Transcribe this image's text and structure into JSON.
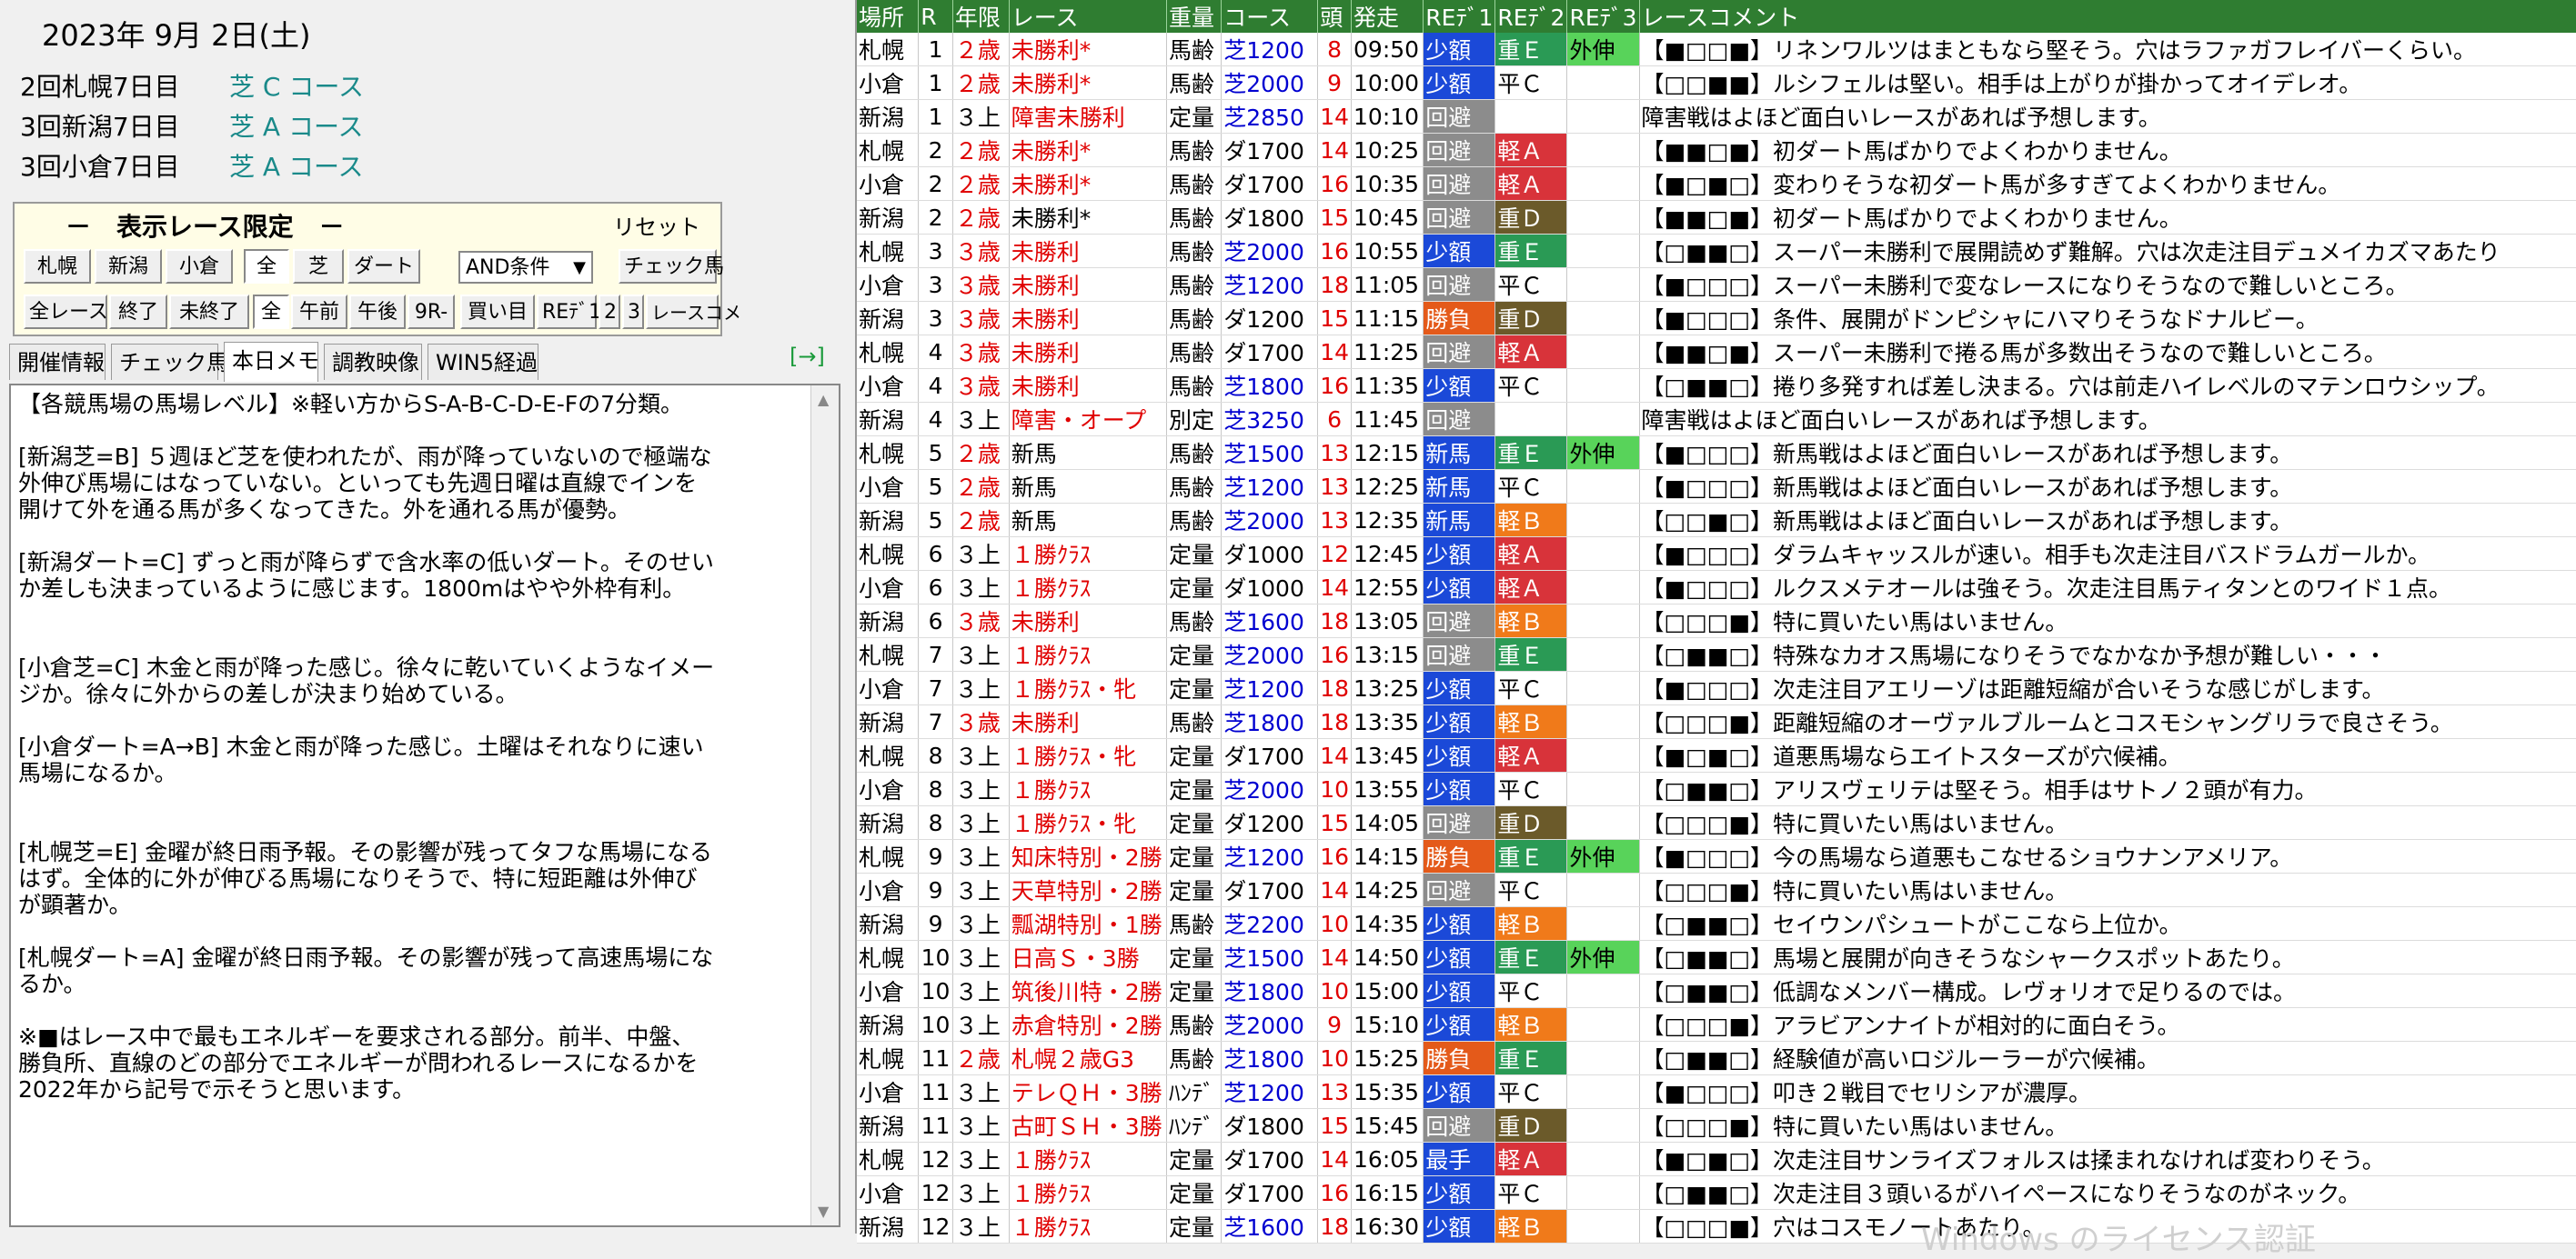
{
  "date": "2023年  9月  2日(土)",
  "meetings": [
    {
      "name": "2回札幌7日目",
      "course": "芝 C コース"
    },
    {
      "name": "3回新潟7日目",
      "course": "芝 A コース"
    },
    {
      "name": "3回小倉7日目",
      "course": "芝 A コース"
    }
  ],
  "filter": {
    "title": "－　表示レース限定　－",
    "reset": "リセット",
    "row1": [
      "札幌",
      "新潟",
      "小倉"
    ],
    "row1b": [
      "全",
      "芝",
      "ダート"
    ],
    "condition": "AND条件",
    "check_btn": "チェック馬",
    "row2a": [
      "全レース",
      "終了",
      "未終了"
    ],
    "row2b": [
      "全",
      "午前",
      "午後",
      "9R-"
    ],
    "row2c": [
      "買い目",
      "REﾃﾞ1",
      "2",
      "3",
      "レースコメ"
    ]
  },
  "tabs": [
    "開催情報",
    "チェック馬",
    "本日メモ",
    "調教映像",
    "WIN5経過"
  ],
  "expand": "[→]",
  "memo": "【各競馬場の馬場レベル】※軽い方からS-A-B-C-D-E-Fの7分類。\n\n[新潟芝=B] ５週ほど芝を使われたが、雨が降っていないので極端な\n外伸び馬場にはなっていない。といっても先週日曜は直線でインを\n開けて外を通る馬が多くなってきた。外を通れる馬が優勢。\n\n[新潟ダート=C] ずっと雨が降らずで含水率の低いダート。そのせい\nか差しも決まっているように感じます。1800mはやや外枠有利。\n\n\n[小倉芝=C] 木金と雨が降った感じ。徐々に乾いていくようなイメー\nジか。徐々に外からの差しが決まり始めている。\n\n[小倉ダート=A→B] 木金と雨が降った感じ。土曜はそれなりに速い\n馬場になるか。\n\n\n[札幌芝=E] 金曜が終日雨予報。その影響が残ってタフな馬場になる\nはず。全体的に外が伸びる馬場になりそうで、特に短距離は外伸び\nが顕著か。\n\n[札幌ダート=A] 金曜が終日雨予報。その影響が残って高速馬場にな\nるか。\n\n※■はレース中で最もエネルギーを要求される部分。前半、中盤、\n勝負所、直線のどの部分でエネルギーが問われるレースになるかを\n2022年から記号で示そうと思います。",
  "columns": [
    "場所",
    "R",
    "年限",
    "レース",
    "重量",
    "コース",
    "頭",
    "発走",
    "REﾃﾞ1",
    "REﾃﾞ2",
    "REﾃﾞ3",
    "レースコメント"
  ],
  "rows": [
    [
      "札幌",
      "1",
      "２歳",
      "未勝利*",
      "馬齢",
      "芝1200",
      "8",
      "09:50",
      "少額",
      "重Ｅ",
      "外伸",
      "【■□□■】リネンワルツはまともなら堅そう。穴はラファガフレイバーくらい。"
    ],
    [
      "小倉",
      "1",
      "２歳",
      "未勝利*",
      "馬齢",
      "芝2000",
      "9",
      "10:00",
      "少額",
      "平Ｃ",
      "",
      "【□□■■】ルシフェルは堅い。相手は上がりが掛かってオイデレオ。"
    ],
    [
      "新潟",
      "1",
      "３上",
      "障害未勝利",
      "定量",
      "芝2850",
      "14",
      "10:10",
      "回避",
      "",
      "",
      "障害戦はよほど面白いレースがあれば予想します。"
    ],
    [
      "札幌",
      "2",
      "２歳",
      "未勝利*",
      "馬齢",
      "ダ1700",
      "14",
      "10:25",
      "回避",
      "軽Ａ",
      "",
      "【■■□■】初ダート馬ばかりでよくわかりません。"
    ],
    [
      "小倉",
      "2",
      "２歳",
      "未勝利*",
      "馬齢",
      "ダ1700",
      "16",
      "10:35",
      "回避",
      "軽Ａ",
      "",
      "【■□■□】変わりそうな初ダート馬が多すぎてよくわかりません。"
    ],
    [
      "新潟",
      "2",
      "２歳",
      "未勝利*",
      "馬齢",
      "ダ1800",
      "15",
      "10:45",
      "回避",
      "重Ｄ",
      "",
      "【■■□■】初ダート馬ばかりでよくわかりません。"
    ],
    [
      "札幌",
      "3",
      "３歳",
      "未勝利",
      "馬齢",
      "芝2000",
      "16",
      "10:55",
      "少額",
      "重Ｅ",
      "",
      "【□■■□】スーパー未勝利で展開読めず難解。穴は次走注目デュメイカズマあたり"
    ],
    [
      "小倉",
      "3",
      "３歳",
      "未勝利",
      "馬齢",
      "芝1200",
      "18",
      "11:05",
      "回避",
      "平Ｃ",
      "",
      "【■□□□】スーパー未勝利で変なレースになりそうなので難しいところ。"
    ],
    [
      "新潟",
      "3",
      "３歳",
      "未勝利",
      "馬齢",
      "ダ1200",
      "15",
      "11:15",
      "勝負",
      "重Ｄ",
      "",
      "【■□□□】条件、展開がドンピシャにハマりそうなドナルビー。"
    ],
    [
      "札幌",
      "4",
      "３歳",
      "未勝利",
      "馬齢",
      "ダ1700",
      "14",
      "11:25",
      "回避",
      "軽Ａ",
      "",
      "【■■□■】スーパー未勝利で捲る馬が多数出そうなので難しいところ。"
    ],
    [
      "小倉",
      "4",
      "３歳",
      "未勝利",
      "馬齢",
      "芝1800",
      "16",
      "11:35",
      "少額",
      "平Ｃ",
      "",
      "【□■■□】捲り多発すれば差し決まる。穴は前走ハイレベルのマテンロウシップ。"
    ],
    [
      "新潟",
      "4",
      "３上",
      "障害・オープ",
      "別定",
      "芝3250",
      "6",
      "11:45",
      "回避",
      "",
      "",
      "障害戦はよほど面白いレースがあれば予想します。"
    ],
    [
      "札幌",
      "5",
      "２歳",
      "新馬",
      "馬齢",
      "芝1500",
      "13",
      "12:15",
      "新馬",
      "重Ｅ",
      "外伸",
      "【■□□□】新馬戦はよほど面白いレースがあれば予想します。"
    ],
    [
      "小倉",
      "5",
      "２歳",
      "新馬",
      "馬齢",
      "芝1200",
      "13",
      "12:25",
      "新馬",
      "平Ｃ",
      "",
      "【■□□□】新馬戦はよほど面白いレースがあれば予想します。"
    ],
    [
      "新潟",
      "5",
      "２歳",
      "新馬",
      "馬齢",
      "芝2000",
      "13",
      "12:35",
      "新馬",
      "軽Ｂ",
      "",
      "【□□■□】新馬戦はよほど面白いレースがあれば予想します。"
    ],
    [
      "札幌",
      "6",
      "３上",
      "１勝ｸﾗｽ",
      "定量",
      "ダ1000",
      "12",
      "12:45",
      "少額",
      "軽Ａ",
      "",
      "【■□□□】ダラムキャッスルが速い。相手も次走注目バスドラムガールか。"
    ],
    [
      "小倉",
      "6",
      "３上",
      "１勝ｸﾗｽ",
      "定量",
      "ダ1000",
      "14",
      "12:55",
      "少額",
      "軽Ａ",
      "",
      "【■□□□】ルクスメテオールは強そう。次走注目馬ティタンとのワイド１点。"
    ],
    [
      "新潟",
      "6",
      "３歳",
      "未勝利",
      "馬齢",
      "芝1600",
      "18",
      "13:05",
      "回避",
      "軽Ｂ",
      "",
      "【□□□■】特に買いたい馬はいません。"
    ],
    [
      "札幌",
      "7",
      "３上",
      "１勝ｸﾗｽ",
      "定量",
      "芝2000",
      "16",
      "13:15",
      "回避",
      "重Ｅ",
      "",
      "【□■■□】特殊なカオス馬場になりそうでなかなか予想が難しい・・・"
    ],
    [
      "小倉",
      "7",
      "３上",
      "１勝ｸﾗｽ・牝",
      "定量",
      "芝1200",
      "18",
      "13:25",
      "少額",
      "平Ｃ",
      "",
      "【■□□□】次走注目アエリーゾは距離短縮が合いそうな感じがします。"
    ],
    [
      "新潟",
      "7",
      "３歳",
      "未勝利",
      "馬齢",
      "芝1800",
      "18",
      "13:35",
      "少額",
      "軽Ｂ",
      "",
      "【□□□■】距離短縮のオーヴァルブルームとコスモシャングリラで良さそう。"
    ],
    [
      "札幌",
      "8",
      "３上",
      "１勝ｸﾗｽ・牝",
      "定量",
      "ダ1700",
      "14",
      "13:45",
      "少額",
      "軽Ａ",
      "",
      "【■□■□】道悪馬場ならエイトスターズが穴候補。"
    ],
    [
      "小倉",
      "8",
      "３上",
      "１勝ｸﾗｽ",
      "定量",
      "芝2000",
      "10",
      "13:55",
      "少額",
      "平Ｃ",
      "",
      "【□■■□】アリスヴェリテは堅そう。相手はサトノ２頭が有力。"
    ],
    [
      "新潟",
      "8",
      "３上",
      "１勝ｸﾗｽ・牝",
      "定量",
      "ダ1200",
      "15",
      "14:05",
      "回避",
      "重Ｄ",
      "",
      "【□□□■】特に買いたい馬はいません。"
    ],
    [
      "札幌",
      "9",
      "３上",
      "知床特別・2勝",
      "定量",
      "芝1200",
      "16",
      "14:15",
      "勝負",
      "重Ｅ",
      "外伸",
      "【■□□□】今の馬場なら道悪もこなせるショウナンアメリア。"
    ],
    [
      "小倉",
      "9",
      "３上",
      "天草特別・2勝",
      "定量",
      "ダ1700",
      "14",
      "14:25",
      "回避",
      "平Ｃ",
      "",
      "【□□□■】特に買いたい馬はいません。"
    ],
    [
      "新潟",
      "9",
      "３上",
      "瓢湖特別・1勝",
      "馬齢",
      "芝2200",
      "10",
      "14:35",
      "少額",
      "軽Ｂ",
      "",
      "【□■■□】セイウンパシュートがここなら上位か。"
    ],
    [
      "札幌",
      "10",
      "３上",
      "日高Ｓ・3勝",
      "定量",
      "芝1500",
      "14",
      "14:50",
      "少額",
      "重Ｅ",
      "外伸",
      "【□■■□】馬場と展開が向きそうなシャークスポットあたり。"
    ],
    [
      "小倉",
      "10",
      "３上",
      "筑後川特・2勝",
      "定量",
      "芝1800",
      "10",
      "15:00",
      "少額",
      "平Ｃ",
      "",
      "【□■■□】低調なメンバー構成。レヴォリオで足りるのでは。"
    ],
    [
      "新潟",
      "10",
      "３上",
      "赤倉特別・2勝",
      "馬齢",
      "芝2000",
      "9",
      "15:10",
      "少額",
      "軽Ｂ",
      "",
      "【□□□■】アラビアンナイトが相対的に面白そう。"
    ],
    [
      "札幌",
      "11",
      "２歳",
      "札幌２歳G3",
      "馬齢",
      "芝1800",
      "10",
      "15:25",
      "勝負",
      "重Ｅ",
      "",
      "【□■■□】経験値が高いロジルーラーが穴候補。"
    ],
    [
      "小倉",
      "11",
      "３上",
      "テレＱＨ・3勝",
      "ﾊﾝﾃﾞ",
      "芝1200",
      "13",
      "15:35",
      "少額",
      "平Ｃ",
      "",
      "【■□□□】叩き２戦目でセリシアが濃厚。"
    ],
    [
      "新潟",
      "11",
      "３上",
      "古町ＳＨ・3勝",
      "ﾊﾝﾃﾞ",
      "ダ1800",
      "15",
      "15:45",
      "回避",
      "重Ｄ",
      "",
      "【□□□■】特に買いたい馬はいません。"
    ],
    [
      "札幌",
      "12",
      "３上",
      "１勝ｸﾗｽ",
      "定量",
      "ダ1700",
      "14",
      "16:05",
      "最手",
      "軽Ａ",
      "",
      "【■□■□】次走注目サンライズフォルスは揉まれなければ変わりそう。"
    ],
    [
      "小倉",
      "12",
      "３上",
      "１勝ｸﾗｽ",
      "定量",
      "ダ1700",
      "16",
      "16:15",
      "少額",
      "平Ｃ",
      "",
      "【□■■□】次走注目３頭いるがハイペースになりそうなのがネック。"
    ],
    [
      "新潟",
      "12",
      "３上",
      "１勝ｸﾗｽ",
      "定量",
      "芝1600",
      "18",
      "16:30",
      "少額",
      "軽Ｂ",
      "",
      "【□□□■】穴はコスモノートあたり。"
    ]
  ],
  "watermark": "Windows のライセンス認証"
}
